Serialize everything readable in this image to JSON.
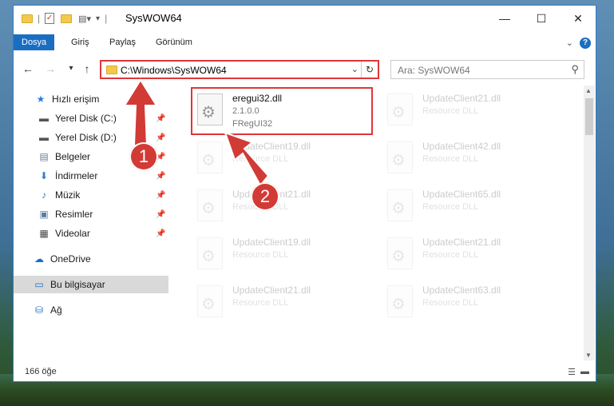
{
  "window": {
    "title": "SysWOW64"
  },
  "ribbon": {
    "tabs": [
      "Dosya",
      "Giriş",
      "Paylaş",
      "Görünüm"
    ]
  },
  "nav": {
    "address": "C:\\Windows\\SysWOW64",
    "search_placeholder": "Ara: SysWOW64"
  },
  "sidebar": {
    "items": [
      {
        "label": "Hızlı erişim",
        "icon": "star-icon"
      },
      {
        "label": "Yerel Disk (C:)",
        "icon": "drive-icon"
      },
      {
        "label": "Yerel Disk (D:)",
        "icon": "drive-icon"
      },
      {
        "label": "Belgeler",
        "icon": "documents-icon"
      },
      {
        "label": "İndirmeler",
        "icon": "download-icon"
      },
      {
        "label": "Müzik",
        "icon": "music-icon"
      },
      {
        "label": "Resimler",
        "icon": "pictures-icon"
      },
      {
        "label": "Videolar",
        "icon": "video-icon"
      },
      {
        "label": "OneDrive",
        "icon": "cloud-icon"
      },
      {
        "label": "Bu bilgisayar",
        "icon": "computer-icon"
      },
      {
        "label": "Ağ",
        "icon": "network-icon"
      }
    ]
  },
  "files": [
    {
      "name": "eregui32.dll",
      "line1": "2.1.0.0",
      "line2": "FRegUI32"
    },
    {
      "name": "UpdateClient21.dll",
      "line1": "Resource DLL"
    },
    {
      "name": "UpdateClient19.dll",
      "line1": "Resource DLL"
    },
    {
      "name": "UpdateClient42.dll",
      "line1": "Resource DLL"
    },
    {
      "name": "UpdateClient21.dll",
      "line1": "Resource DLL"
    },
    {
      "name": "UpdateClient65.dll",
      "line1": "Resource DLL"
    },
    {
      "name": "UpdateClient19.dll",
      "line1": "Resource DLL"
    },
    {
      "name": "UpdateClient21.dll",
      "line1": "Resource DLL"
    },
    {
      "name": "UpdateClient21.dll",
      "line1": "Resource DLL"
    },
    {
      "name": "UpdateClient63.dll",
      "line1": "Resource DLL"
    }
  ],
  "status": {
    "count": "166 öğe"
  },
  "annotations": {
    "step1": "1",
    "step2": "2",
    "color": "#d23a36"
  }
}
